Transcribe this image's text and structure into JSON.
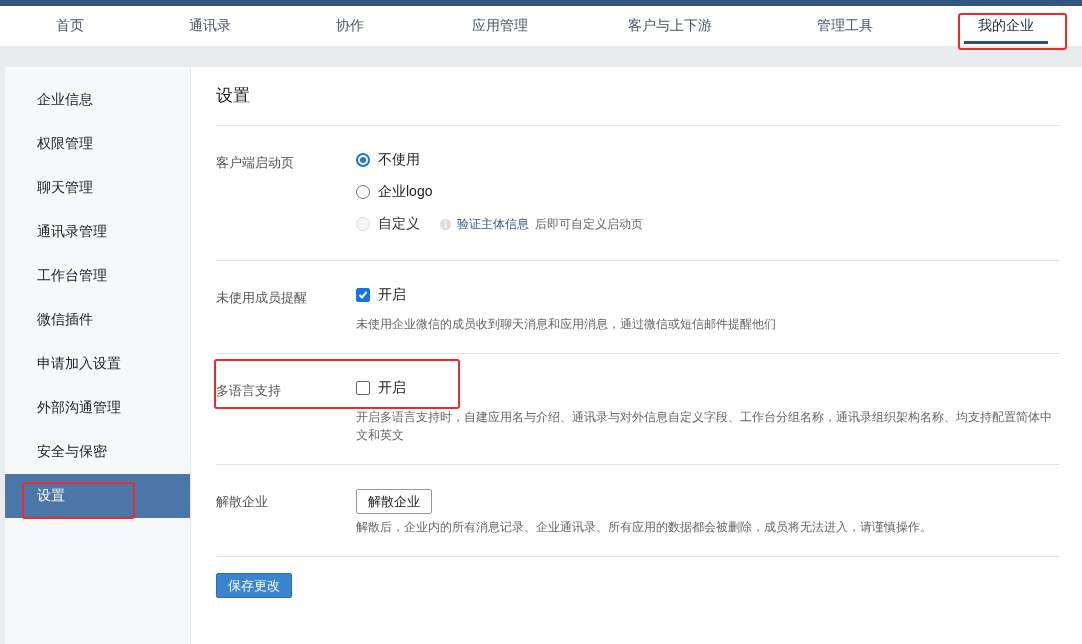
{
  "top_nav": {
    "tabs": [
      {
        "label": "首页",
        "selected": false,
        "highlighted": false
      },
      {
        "label": "通讯录",
        "selected": false,
        "highlighted": false
      },
      {
        "label": "协作",
        "selected": false,
        "highlighted": false
      },
      {
        "label": "应用管理",
        "selected": false,
        "highlighted": false
      },
      {
        "label": "客户与上下游",
        "selected": false,
        "highlighted": false
      },
      {
        "label": "管理工具",
        "selected": false,
        "highlighted": false
      },
      {
        "label": "我的企业",
        "selected": true,
        "highlighted": true
      }
    ]
  },
  "sidebar": {
    "items": [
      {
        "label": "企业信息",
        "selected": false,
        "highlighted": false
      },
      {
        "label": "权限管理",
        "selected": false,
        "highlighted": false
      },
      {
        "label": "聊天管理",
        "selected": false,
        "highlighted": false
      },
      {
        "label": "通讯录管理",
        "selected": false,
        "highlighted": false
      },
      {
        "label": "工作台管理",
        "selected": false,
        "highlighted": false
      },
      {
        "label": "微信插件",
        "selected": false,
        "highlighted": false
      },
      {
        "label": "申请加入设置",
        "selected": false,
        "highlighted": false
      },
      {
        "label": "外部沟通管理",
        "selected": false,
        "highlighted": false
      },
      {
        "label": "安全与保密",
        "selected": false,
        "highlighted": false
      },
      {
        "label": "设置",
        "selected": true,
        "highlighted": true
      }
    ]
  },
  "settings": {
    "title": "设置",
    "sections": [
      {
        "kind": "radio",
        "label": "客户端启动页",
        "highlighted": false,
        "options": [
          {
            "label": "不使用",
            "selected": true,
            "disabled": false
          },
          {
            "label": "企业logo",
            "selected": false,
            "disabled": false
          },
          {
            "label": "自定义",
            "selected": false,
            "disabled": true,
            "hint_link": "验证主体信息",
            "hint": "后即可自定义启动页"
          }
        ]
      },
      {
        "kind": "checkbox",
        "label": "未使用成员提醒",
        "highlighted": false,
        "option": "开启",
        "checked": true,
        "description": "未使用企业微信的成员收到聊天消息和应用消息，通过微信或短信邮件提醒他们"
      },
      {
        "kind": "checkbox",
        "label": "多语言支持",
        "highlighted": true,
        "option": "开启",
        "checked": false,
        "description": "开启多语言支持时，自建应用名与介绍、通讯录与对外信息自定义字段、工作台分组名称，通讯录组织架构名称、均支持配置简体中文和英文"
      },
      {
        "kind": "button",
        "label": "解散企业",
        "highlighted": false,
        "button": "解散企业",
        "description": "解散后，企业内的所有消息记录、企业通讯录、所有应用的数据都会被删除，成员将无法进入，请谨慎操作。"
      }
    ],
    "save_button": "保存更改"
  }
}
